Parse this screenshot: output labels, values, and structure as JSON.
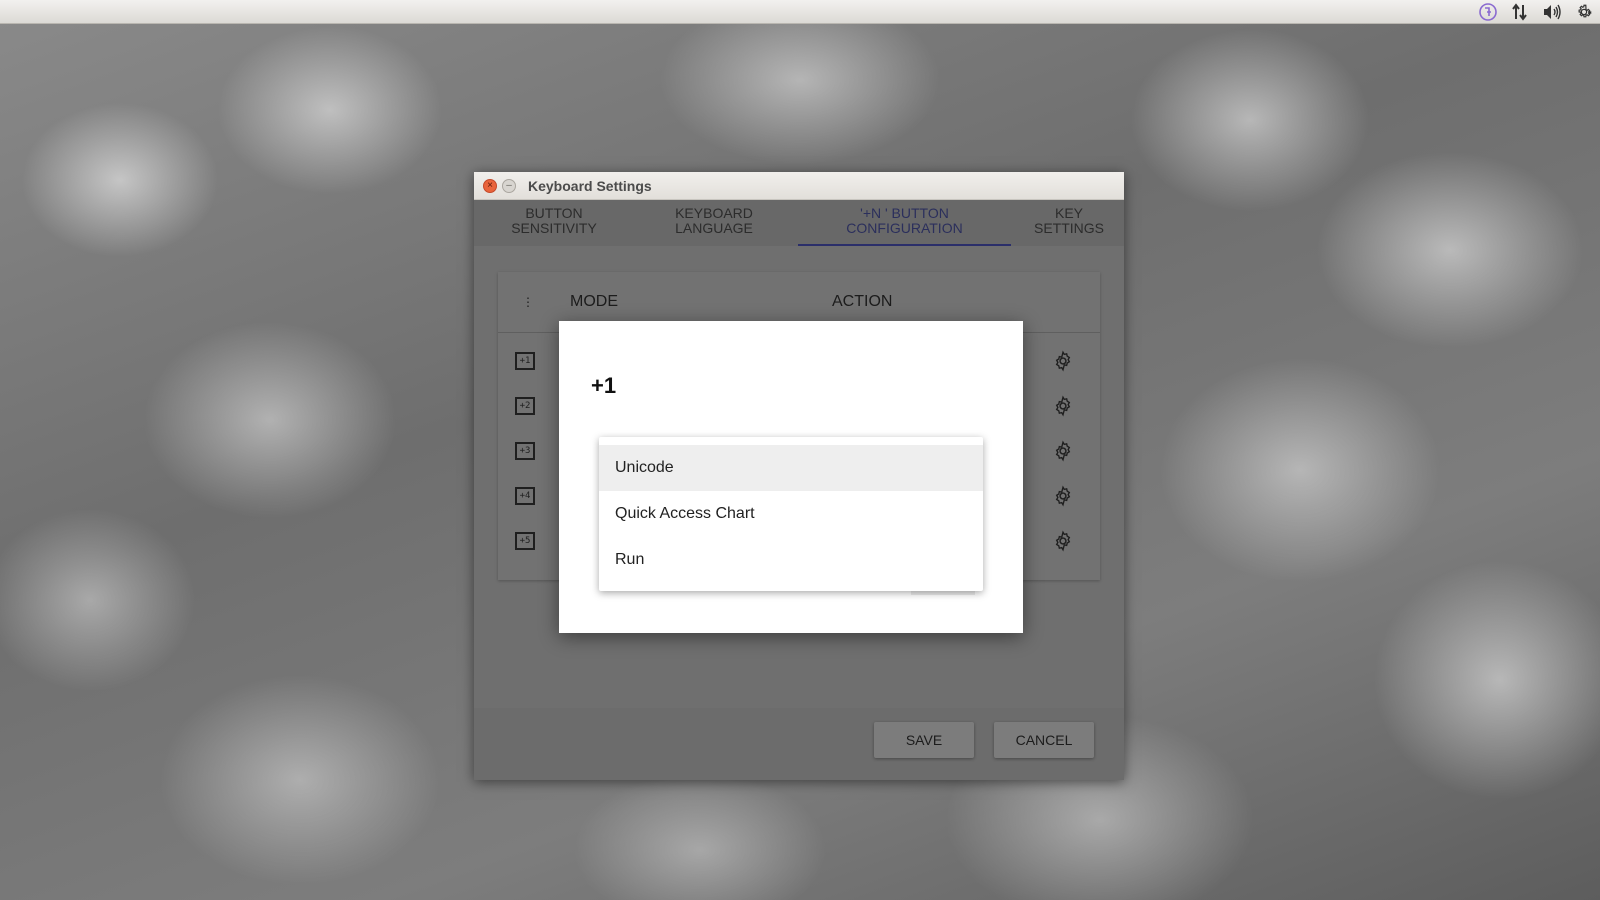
{
  "top_panel": {
    "tray_icons": [
      "ime-icon",
      "network-transfer-icon",
      "volume-icon",
      "settings-gear-icon"
    ]
  },
  "window": {
    "title": "Keyboard Settings",
    "tabs": [
      {
        "line1": "BUTTON",
        "line2": "SENSITIVITY",
        "active": false
      },
      {
        "line1": "KEYBOARD",
        "line2": "LANGUAGE",
        "active": false
      },
      {
        "line1": "'+N ' BUTTON",
        "line2": "CONFIGURATION",
        "active": true
      },
      {
        "line1": "KEY",
        "line2": "SETTINGS",
        "active": false
      }
    ],
    "table": {
      "col_icon": "⋮",
      "col_mode": "MODE",
      "col_action": "ACTION",
      "rows": [
        {
          "icon_label": "+1"
        },
        {
          "icon_label": "+2"
        },
        {
          "icon_label": "+3"
        },
        {
          "icon_label": "+4"
        },
        {
          "icon_label": "+5"
        }
      ]
    },
    "footer": {
      "save_label": "SAVE",
      "cancel_label": "CANCEL"
    }
  },
  "modal": {
    "title": "+1"
  },
  "dropdown": {
    "options": [
      "Unicode",
      "Quick Access Chart",
      "Run"
    ],
    "selected": "Unicode"
  },
  "colors": {
    "active_tab": "#2b2f5c",
    "close_button": "#e9643c",
    "tray_ime_accent": "#8a6ad0"
  }
}
